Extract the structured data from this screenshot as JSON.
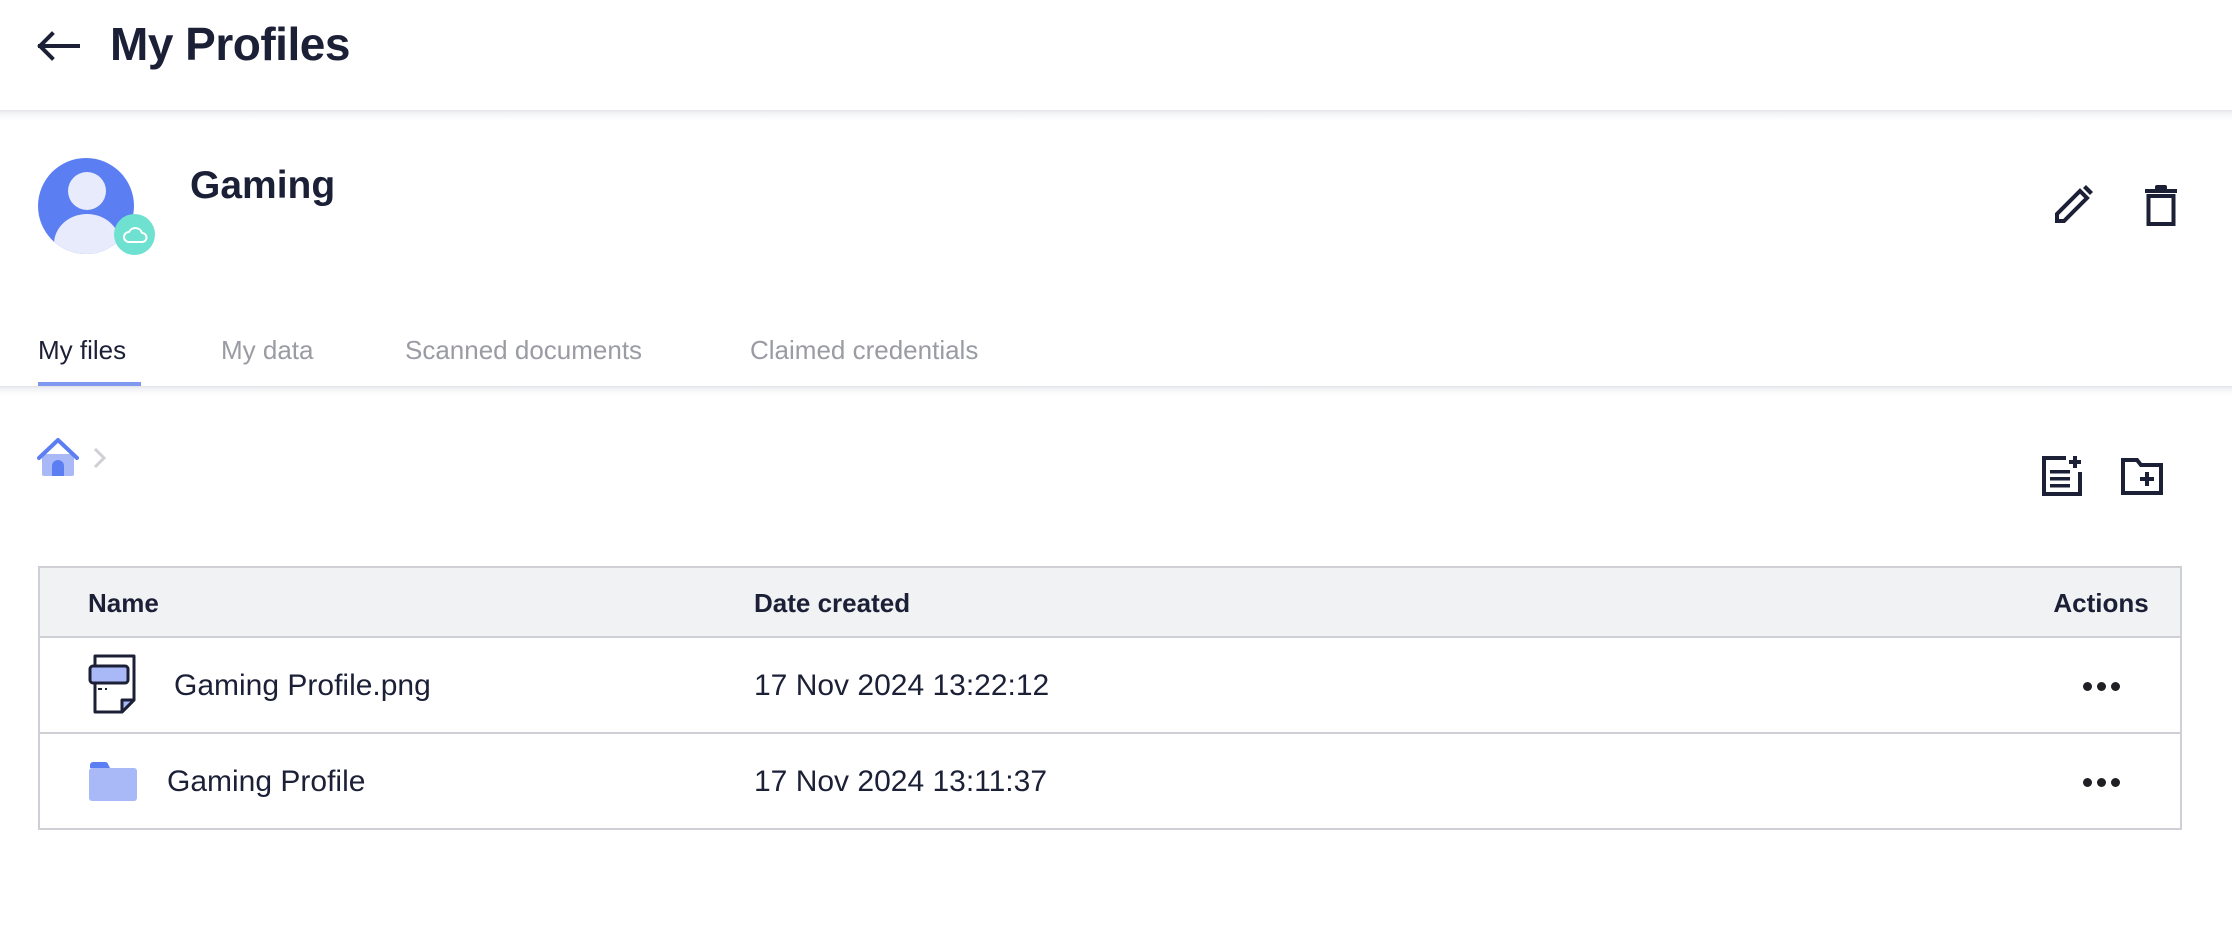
{
  "header": {
    "title": "My Profiles",
    "back_icon": "arrow-left-icon"
  },
  "profile": {
    "name": "Gaming",
    "avatar_icon": "user-avatar-icon",
    "status_badge_icon": "cloud-icon",
    "actions": [
      {
        "id": "edit",
        "icon": "pencil-icon"
      },
      {
        "id": "delete",
        "icon": "trash-icon"
      }
    ]
  },
  "tabs": [
    {
      "label": "My files",
      "active": true
    },
    {
      "label": "My data",
      "active": false
    },
    {
      "label": "Scanned documents",
      "active": false
    },
    {
      "label": "Claimed credentials",
      "active": false
    }
  ],
  "breadcrumb": {
    "home_icon": "home-icon",
    "separator_icon": "chevron-right-icon"
  },
  "toolbar": {
    "add_document_icon": "note-add-icon",
    "add_folder_icon": "folder-add-icon"
  },
  "table": {
    "columns": [
      "Name",
      "Date created",
      "Actions"
    ],
    "rows": [
      {
        "type": "file",
        "icon": "image-file-icon",
        "name": "Gaming Profile.png",
        "date_created": "17 Nov 2024 13:22:12",
        "action_icon": "more-horizontal-icon"
      },
      {
        "type": "folder",
        "icon": "folder-icon",
        "name": "Gaming Profile",
        "date_created": "17 Nov 2024 13:11:37",
        "action_icon": "more-horizontal-icon"
      }
    ]
  },
  "colors": {
    "text_primary": "#1b2037",
    "text_muted": "#9a9ba3",
    "accent": "#5b7ff2",
    "accent_light": "#a9b9f7",
    "tab_indicator": "#7f99f0",
    "cloud_badge": "#6fe1d0",
    "table_header_bg": "#f1f2f4",
    "border": "#cfcfd6"
  }
}
